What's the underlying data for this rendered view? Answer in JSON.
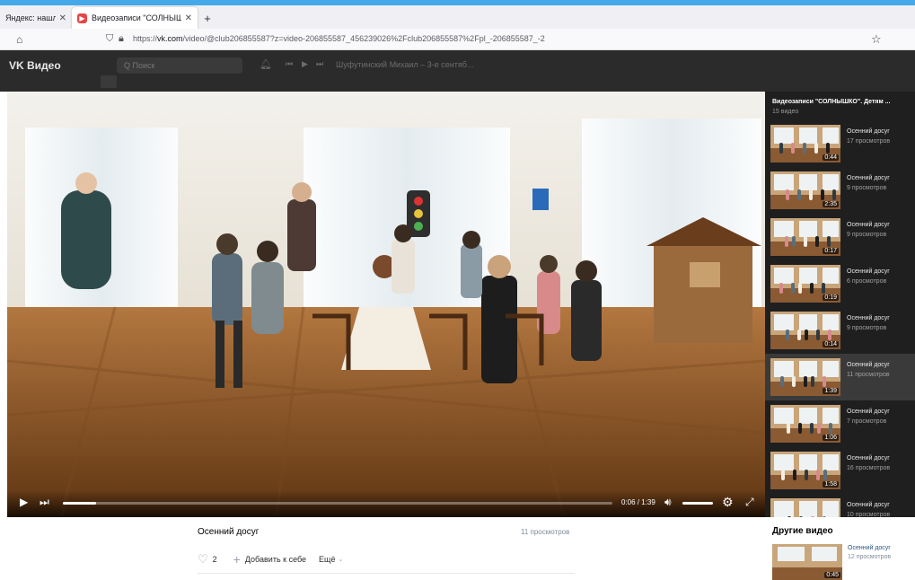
{
  "browser": {
    "tabs": [
      {
        "title": "Яндекс: нашлось",
        "close": "✕"
      },
      {
        "title": "Видеозаписи \"СОЛНЫШКО\". Д",
        "close": "✕"
      }
    ],
    "new_tab": "+",
    "url_prefix": "https://",
    "url_domain": "vk.com",
    "url_rest": "/video/@club206855587?z=video-206855587_456239026%2Fclub206855587%2Fpl_-206855587_-2"
  },
  "vk_header": {
    "logo": "VK Видео",
    "search_placeholder": "Q Поиск",
    "mini_track": "Шуфутинский Михаил – 3-е сентяб..."
  },
  "player": {
    "current_time": "0:06",
    "separator": " / ",
    "total_time": "1:39",
    "progress": 0.06
  },
  "playlist": {
    "title": "Видеозаписи \"СОЛНЫШКО\". Детям ...",
    "count": "15 видео",
    "active_index": 5,
    "items": [
      {
        "name": "Осенний досуг",
        "views": "17 просмотров",
        "duration": "0:44"
      },
      {
        "name": "Осенний досуг",
        "views": "9 просмотров",
        "duration": "2:35"
      },
      {
        "name": "Осенний досуг",
        "views": "9 просмотров",
        "duration": "0:17"
      },
      {
        "name": "Осенний досуг",
        "views": "6 просмотров",
        "duration": "0:19"
      },
      {
        "name": "Осенний досуг",
        "views": "9 просмотров",
        "duration": "0:14"
      },
      {
        "name": "Осенний досуг",
        "views": "11 просмотров",
        "duration": "1:39"
      },
      {
        "name": "Осенний досуг",
        "views": "7 просмотров",
        "duration": "1:06"
      },
      {
        "name": "Осенний досуг",
        "views": "16 просмотров",
        "duration": "1:58"
      },
      {
        "name": "Осенний досуг",
        "views": "10 просмотров",
        "duration": ""
      }
    ]
  },
  "video_info": {
    "title": "Осенний досуг",
    "views": "11 просмотров",
    "likes": "2",
    "add_label": "Добавить к себе",
    "more_label": "Ещё"
  },
  "other_videos": {
    "heading": "Другие видео",
    "item": {
      "name": "Осенний досуг",
      "views": "12 просмотров",
      "duration": "0:45"
    }
  }
}
